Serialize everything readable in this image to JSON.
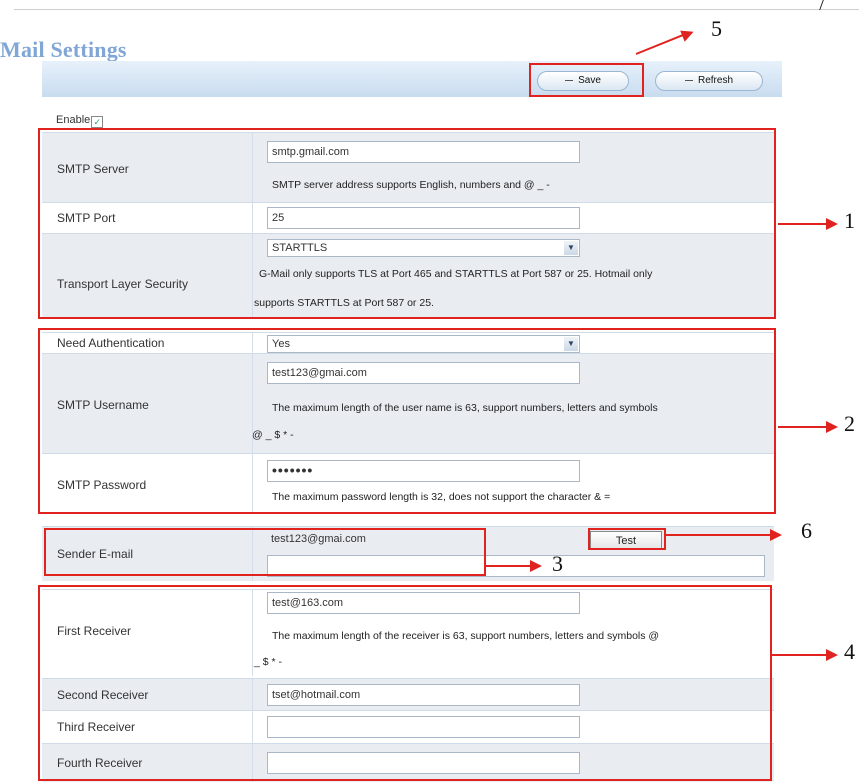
{
  "page": {
    "title": "Mail Settings"
  },
  "toolbar": {
    "save_label": "Save",
    "refresh_label": "Refresh"
  },
  "enable": {
    "label": "Enable",
    "checked": true
  },
  "smtp_server": {
    "label": "SMTP Server",
    "value": "smtp.gmail.com",
    "note": "SMTP server address supports English, numbers and @ _ -"
  },
  "smtp_port": {
    "label": "SMTP Port",
    "value": "25"
  },
  "tls": {
    "label": "Transport Layer Security",
    "selected": "STARTTLS",
    "note_line1": "G-Mail only supports TLS at Port 465 and STARTTLS at Port 587 or 25. Hotmail only",
    "note_line2": "supports STARTTLS at Port 587 or 25."
  },
  "auth": {
    "label": "Need Authentication",
    "selected": "Yes"
  },
  "smtp_username": {
    "label": "SMTP Username",
    "value": "test123@gmai.com",
    "note_line1": "The maximum length of the user name is 63, support numbers, letters and symbols",
    "note_line2": "@ _ $ * -"
  },
  "smtp_password": {
    "label": "SMTP Password",
    "value": "•••••••",
    "note": "The maximum password length is 32, does not support the character & ="
  },
  "sender": {
    "label": "Sender E-mail",
    "value": "test123@gmai.com",
    "test_label": "Test"
  },
  "first_receiver": {
    "label": "First Receiver",
    "value": "test@163.com",
    "note_line1": "The maximum length of the receiver is 63, support numbers, letters and symbols @",
    "note_line2": "_ $ * -"
  },
  "second_receiver": {
    "label": "Second Receiver",
    "value": "tset@hotmail.com"
  },
  "third_receiver": {
    "label": "Third Receiver",
    "value": ""
  },
  "fourth_receiver": {
    "label": "Fourth Receiver",
    "value": ""
  },
  "annotations": {
    "n1": "1",
    "n2": "2",
    "n3": "3",
    "n4": "4",
    "n5": "5",
    "n6": "6"
  },
  "colors": {
    "annotation_red": "#e0231f",
    "title_blue": "#7fa6d6",
    "toolbar_blue": "#c8dcef",
    "row_gray": "#e9edf2"
  }
}
